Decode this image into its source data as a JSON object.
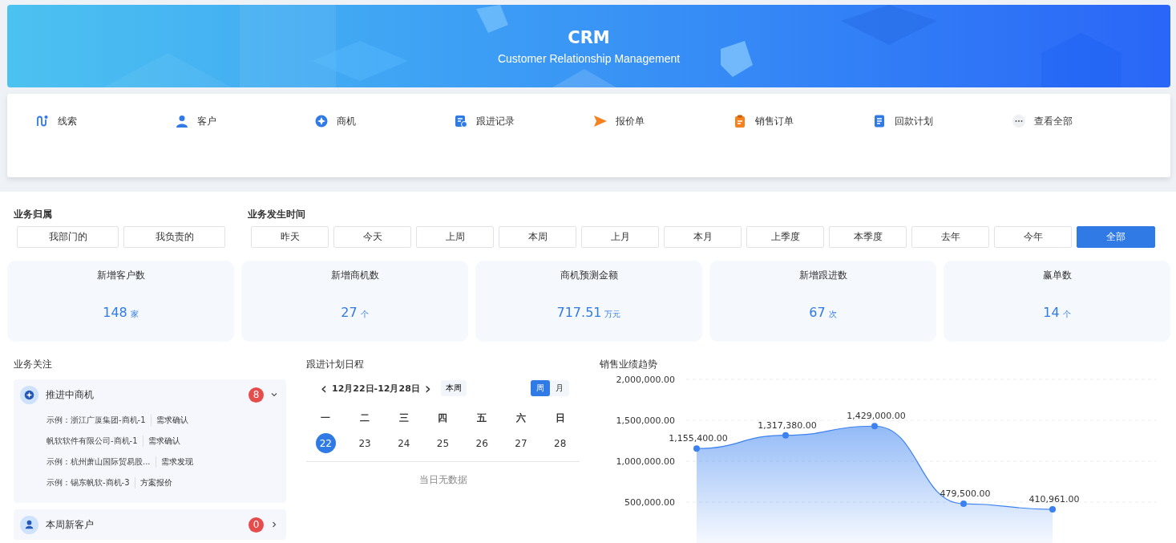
{
  "banner": {
    "title": "CRM",
    "subtitle": "Customer Relationship Management"
  },
  "shortcuts": [
    {
      "label": "线索"
    },
    {
      "label": "客户"
    },
    {
      "label": "商机"
    },
    {
      "label": "跟进记录"
    },
    {
      "label": "报价单"
    },
    {
      "label": "销售订单"
    },
    {
      "label": "回款计划"
    },
    {
      "label": "查看全部"
    }
  ],
  "filters": {
    "owner": {
      "title": "业务归属",
      "options": [
        {
          "label": "我部门的",
          "selected": false
        },
        {
          "label": "我负责的",
          "selected": false
        }
      ]
    },
    "time": {
      "title": "业务发生时间",
      "options": [
        {
          "label": "昨天",
          "selected": false
        },
        {
          "label": "今天",
          "selected": false
        },
        {
          "label": "上周",
          "selected": false
        },
        {
          "label": "本周",
          "selected": false
        },
        {
          "label": "上月",
          "selected": false
        },
        {
          "label": "本月",
          "selected": false
        },
        {
          "label": "上季度",
          "selected": false
        },
        {
          "label": "本季度",
          "selected": false
        },
        {
          "label": "去年",
          "selected": false
        },
        {
          "label": "今年",
          "selected": false
        },
        {
          "label": "全部",
          "selected": true
        }
      ]
    }
  },
  "stats": [
    {
      "label": "新增客户数",
      "value": "148",
      "unit": "家"
    },
    {
      "label": "新增商机数",
      "value": "27",
      "unit": "个"
    },
    {
      "label": "商机预测金额",
      "value": "717.51",
      "unit": "万元"
    },
    {
      "label": "新增跟进数",
      "value": "67",
      "unit": "次"
    },
    {
      "label": "赢单数",
      "value": "14",
      "unit": "个"
    }
  ],
  "focus": {
    "title": "业务关注",
    "sections": [
      {
        "title": "推进中商机",
        "count": "8",
        "expanded": true,
        "items": [
          {
            "name": "示例：浙江广厦集团-商机-1",
            "stage": "需求确认"
          },
          {
            "name": "帆软软件有限公司-商机-1",
            "stage": "需求确认"
          },
          {
            "name": "示例：杭州萧山国际贸易股...",
            "stage": "需求发现"
          },
          {
            "name": "示例：锡东帆软-商机-3",
            "stage": "方案报价"
          }
        ]
      },
      {
        "title": "本周新客户",
        "count": "0",
        "expanded": false
      }
    ]
  },
  "schedule": {
    "title": "跟进计划日程",
    "prev": "‹",
    "range": "12月22日-12月28日",
    "next": "›",
    "today": "本周",
    "modes": [
      {
        "label": "周",
        "selected": true
      },
      {
        "label": "月",
        "selected": false
      }
    ],
    "weekdays": [
      "一",
      "二",
      "三",
      "四",
      "五",
      "六",
      "日"
    ],
    "days": [
      {
        "label": "22",
        "selected": true
      },
      {
        "label": "23",
        "selected": false
      },
      {
        "label": "24",
        "selected": false
      },
      {
        "label": "25",
        "selected": false
      },
      {
        "label": "26",
        "selected": false
      },
      {
        "label": "27",
        "selected": false
      },
      {
        "label": "28",
        "selected": false
      }
    ],
    "empty": "当日无数据"
  },
  "trend": {
    "title": "销售业绩趋势",
    "chart_data": {
      "type": "area",
      "ylim": [
        0,
        2000000
      ],
      "yticks": [
        {
          "value": 500000,
          "label": "500,000.00"
        },
        {
          "value": 1000000,
          "label": "1,000,000.00"
        },
        {
          "value": 1500000,
          "label": "1,500,000.00"
        },
        {
          "value": 2000000,
          "label": "2,000,000.00"
        }
      ],
      "grid": true,
      "series": [
        {
          "color": "#3b82f0",
          "values": [
            1155400,
            1317380,
            1429000,
            479500,
            410961
          ]
        }
      ],
      "value_labels": [
        "1,155,400.00",
        "1,317,380.00",
        "1,429,000.00",
        "479,500.00",
        "410,961.00"
      ]
    }
  }
}
